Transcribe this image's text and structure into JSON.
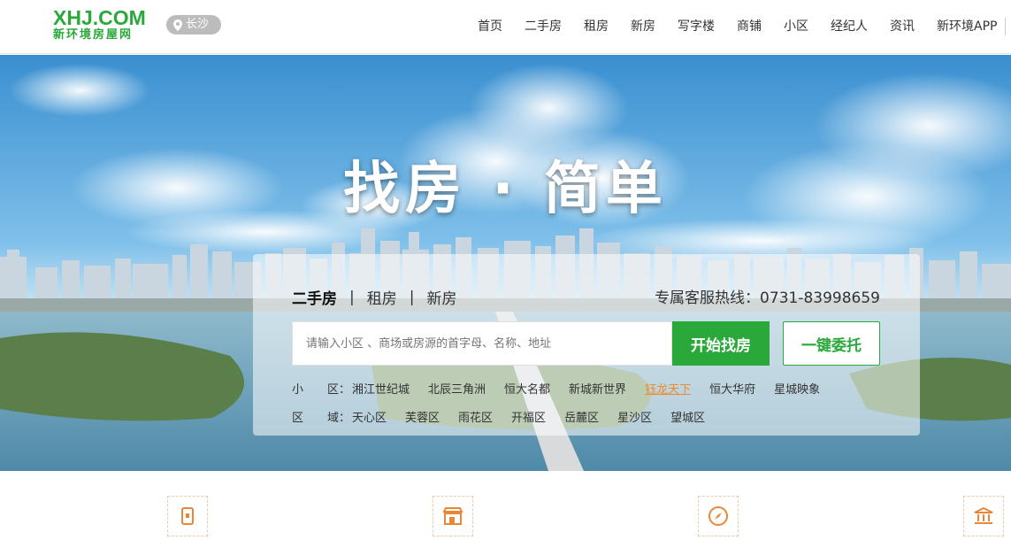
{
  "header": {
    "logo_main": "XHJ.COM",
    "logo_sub": "新环境房屋网",
    "city": "长沙",
    "nav": [
      "首页",
      "二手房",
      "租房",
      "新房",
      "写字楼",
      "商铺",
      "小区",
      "经纪人",
      "资讯",
      "新环境APP"
    ]
  },
  "hero": {
    "slogan": "找房 · 简单"
  },
  "search": {
    "tabs": [
      "二手房",
      "租房",
      "新房"
    ],
    "hotline": "专属客服热线：0731-83998659",
    "placeholder": "请输入小区 、商场或房源的首字母、名称、地址",
    "search_button": "开始找房",
    "entrust_button": "一键委托",
    "community_label_a": "小",
    "community_label_b": "区：",
    "communities": [
      "湘江世纪城",
      "北辰三角洲",
      "恒大名都",
      "新城新世界",
      "钰龙天下",
      "恒大华府",
      "星城映象"
    ],
    "highlighted_community": "钰龙天下",
    "district_label_a": "区",
    "district_label_b": "域：",
    "districts": [
      "天心区",
      "芙蓉区",
      "雨花区",
      "开福区",
      "岳麓区",
      "星沙区",
      "望城区"
    ]
  },
  "colors": {
    "brand_green": "#2aa83a",
    "highlight_orange": "#f08a28",
    "icon_orange": "#e8873a"
  },
  "features": {
    "icons": [
      "phone-icon",
      "store-icon",
      "compass-icon",
      "bank-icon"
    ]
  }
}
